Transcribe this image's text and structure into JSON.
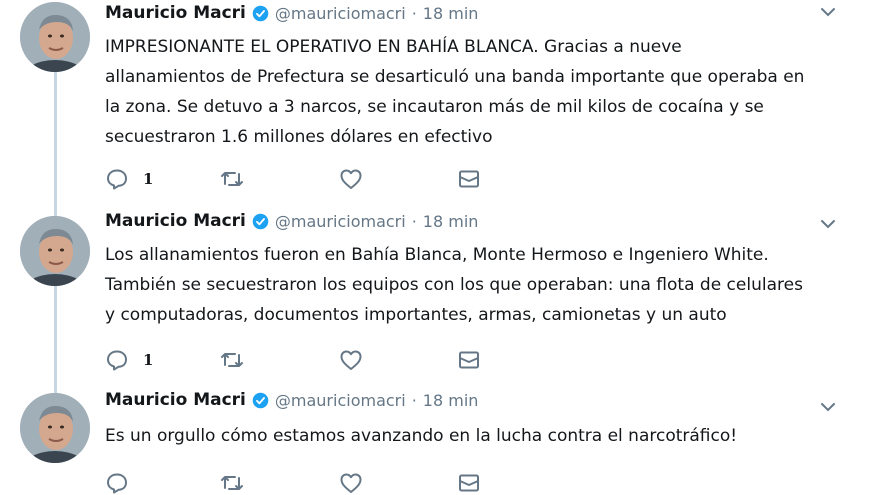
{
  "tweets": [
    {
      "name": "Mauricio Macri",
      "handle": "@mauriciomacri",
      "separator": "·",
      "time": "18 min",
      "lines": [
        "IMPRESIONANTE EL OPERATIVO EN BAHÍA BLANCA. Gracias a nueve",
        "allanamientos de Prefectura se desarticuló una banda importante que operaba en",
        "la zona. Se detuvo a 3 narcos, se incautaron más de mil kilos de cocaína y se",
        "secuestraron 1.6 millones dólares en efectivo"
      ],
      "reply_count": "1"
    },
    {
      "name": "Mauricio Macri",
      "handle": "@mauriciomacri",
      "separator": "·",
      "time": "18 min",
      "lines": [
        "Los allanamientos fueron en Bahía Blanca, Monte Hermoso e Ingeniero White.",
        "También se secuestraron los equipos con los que operaban: una flota de celulares",
        "y computadoras, documentos importantes, armas, camionetas y un auto"
      ],
      "reply_count": "1"
    },
    {
      "name": "Mauricio Macri",
      "handle": "@mauriciomacri",
      "separator": "·",
      "time": "18 min",
      "lines": [
        "Es un orgullo cómo estamos avanzando en la lucha contra el narcotráfico!"
      ],
      "reply_count": ""
    }
  ],
  "icons": {
    "verified": "verified-badge-icon",
    "menu": "chevron-down-icon",
    "reply": "reply-icon",
    "retweet": "retweet-icon",
    "like": "heart-icon",
    "dm": "envelope-icon"
  },
  "colors": {
    "text": "#14171a",
    "secondary": "#657786",
    "verified": "#1da1f2",
    "thread_line": "#c6d6e3"
  }
}
